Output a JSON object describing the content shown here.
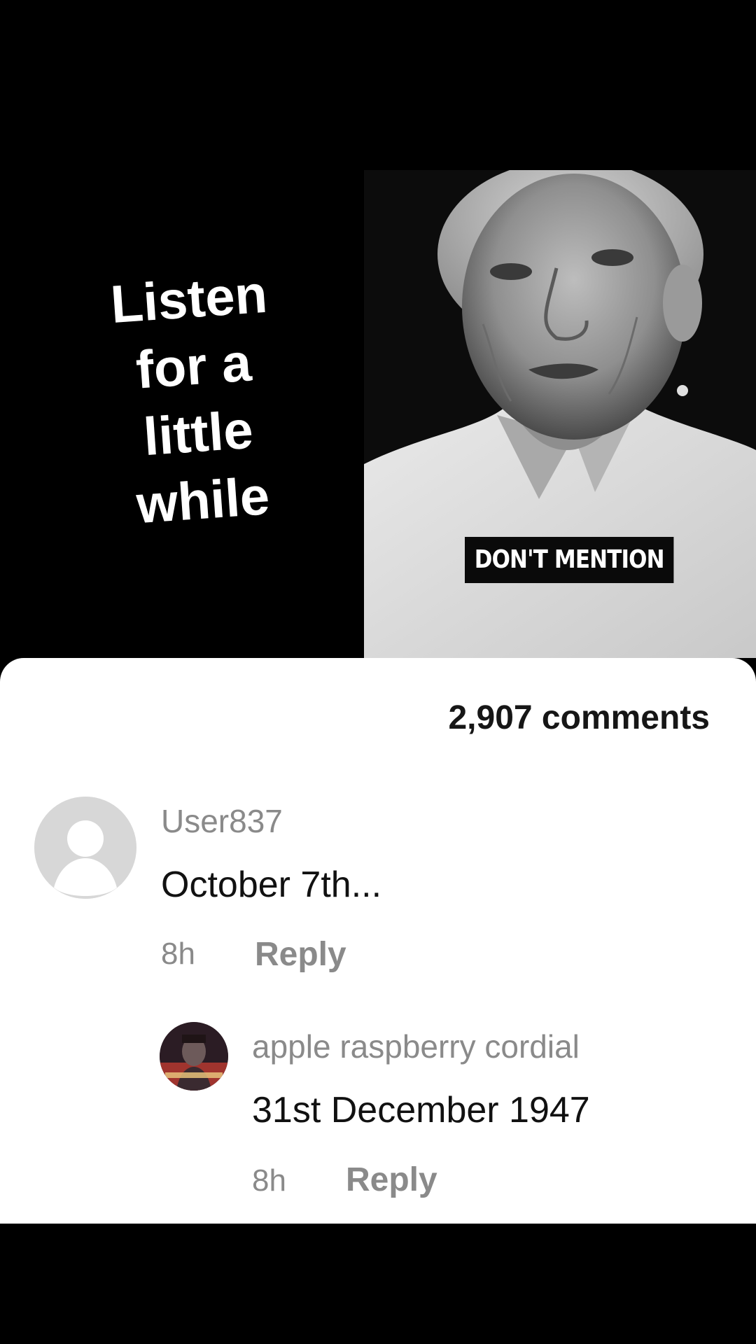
{
  "video": {
    "caption_lines": [
      "Listen",
      "for a",
      "little",
      "while"
    ],
    "subtitle": "DON'T MENTION"
  },
  "comments_panel": {
    "count_label": "2,907 comments",
    "comments": [
      {
        "username": "User837",
        "text": "October 7th...",
        "time": "8h",
        "reply_label": "Reply",
        "avatar": "default-avatar-icon"
      }
    ],
    "replies": [
      {
        "username": "apple raspberry cordial",
        "text": "31st December 1947",
        "time": "8h",
        "reply_label": "Reply",
        "avatar": "profile-photo"
      }
    ]
  },
  "colors": {
    "background": "#000000",
    "sheet": "#ffffff",
    "muted_text": "#8a8a8a",
    "primary_text": "#111111"
  }
}
